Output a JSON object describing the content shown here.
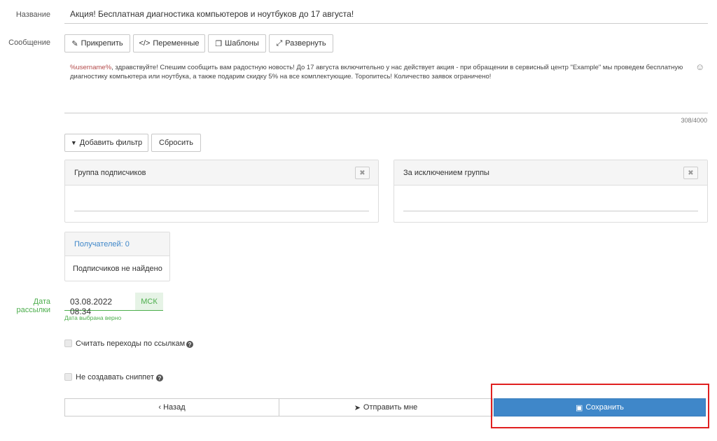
{
  "colors": {
    "accent": "#3f87c9",
    "success": "#4cae4c",
    "highlight_border": "#e02020",
    "variable": "#b34a4a"
  },
  "form": {
    "name_label": "Название",
    "name_value": "Акция! Бесплатная диагностика компьютеров и ноутбуков до 17 августа!",
    "message_label": "Сообщение",
    "toolbar": {
      "attach": {
        "icon": "paperclip-icon",
        "label": "Прикрепить"
      },
      "variables": {
        "icon": "code-icon",
        "label": "Переменные"
      },
      "templates": {
        "icon": "copy-icon",
        "label": "Шаблоны"
      },
      "expand": {
        "icon": "expand-icon",
        "label": "Развернуть"
      }
    },
    "message_variable": "%username%",
    "message_line1": ", здравствуйте! Спешим сообщить вам радостную новость! До 17 августа включительно у нас действует акция - при обращении в сервисный центр \"Example\" мы проведем бесплатную",
    "message_line2": "диагностику компьютера или ноутбука, а также подарим скидку 5% на все комплектующие. Торопитесь! Количество заявок ограничено!",
    "emoji_icon": "smiley-icon",
    "char_count": "308/4000"
  },
  "filters": {
    "add_filter": {
      "icon": "filter-icon",
      "label": "Добавить фильтр"
    },
    "reset": "Сбросить",
    "include_group": {
      "title": "Группа подписчиков",
      "remove_icon": "close-icon"
    },
    "exclude_group": {
      "title": "За исключением группы",
      "remove_icon": "close-icon"
    }
  },
  "recipients": {
    "title": "Получателей: 0",
    "empty": "Подписчиков не найдено"
  },
  "schedule": {
    "label": "Дата рассылки",
    "date_value": "03.08.2022 08:34",
    "timezone": "МСК",
    "hint": "Дата выбрана верно"
  },
  "options": {
    "track_links": {
      "label": "Считать переходы по ссылкам",
      "checked": false
    },
    "no_snippet": {
      "label": "Не создавать сниппет",
      "checked": false
    }
  },
  "footer": {
    "back": "‹ Назад",
    "send_me": {
      "icon": "send-icon",
      "label": "Отправить мне"
    },
    "save": {
      "icon": "save-icon",
      "label": "Сохранить"
    }
  }
}
